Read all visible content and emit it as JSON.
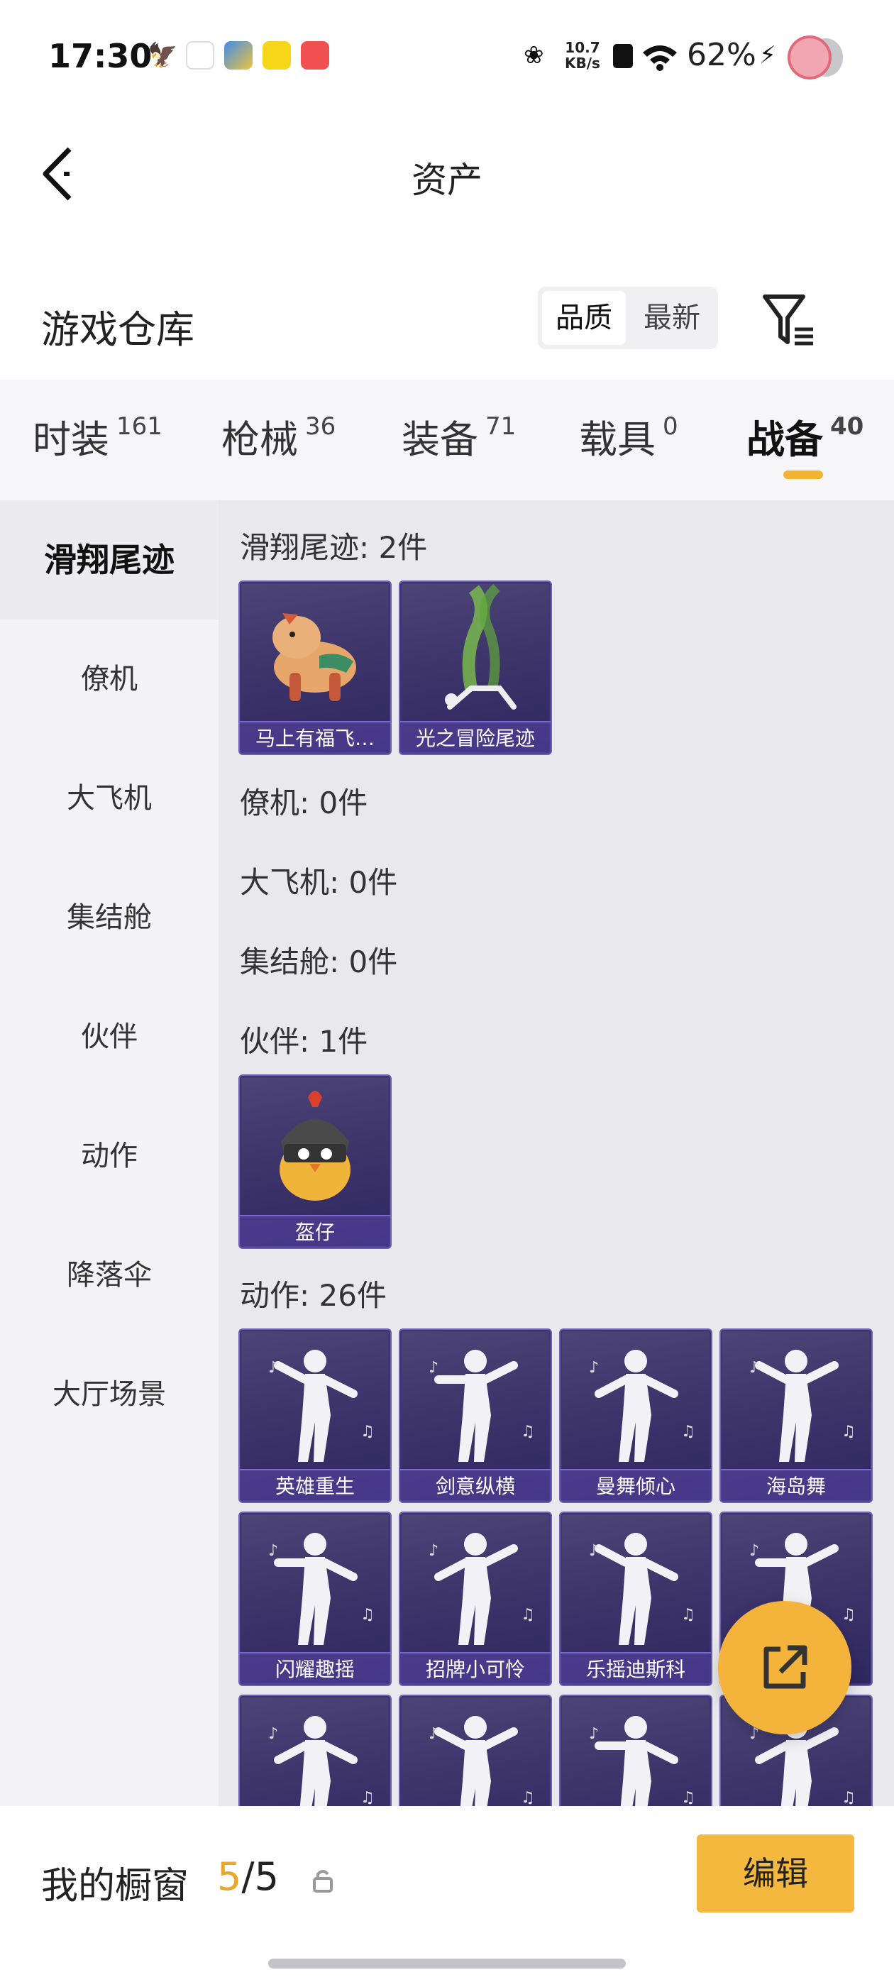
{
  "status_bar": {
    "time": "17:30",
    "net_speed_value": "10.7",
    "net_speed_unit": "KB/s",
    "battery": "62%",
    "icons": [
      "bird-icon",
      "calendar-icon",
      "game-app-icon",
      "yellow-app-icon",
      "red-app-icon",
      "flower-icon",
      "sim-icon",
      "wifi-icon",
      "charging-icon"
    ]
  },
  "header": {
    "title": "资产",
    "back_icon": "chevron-left-icon"
  },
  "section": {
    "title": "游戏仓库",
    "sort_options": [
      "品质",
      "最新"
    ],
    "selected_sort": "品质",
    "filter_icon": "filter-icon"
  },
  "tabs": [
    {
      "label": "时装",
      "count": "161"
    },
    {
      "label": "枪械",
      "count": "36"
    },
    {
      "label": "装备",
      "count": "71"
    },
    {
      "label": "载具",
      "count": "0"
    },
    {
      "label": "战备",
      "count": "40"
    }
  ],
  "active_tab": "战备",
  "sidebar": [
    "滑翔尾迹",
    "僚机",
    "大飞机",
    "集结舱",
    "伙伴",
    "动作",
    "降落伞",
    "大厅场景"
  ],
  "active_sidebar": "滑翔尾迹",
  "groups": [
    {
      "title": "滑翔尾迹: 2件",
      "items": [
        "马上有福飞…",
        "光之冒险尾迹"
      ]
    },
    {
      "title": "僚机: 0件",
      "items": []
    },
    {
      "title": "大飞机: 0件",
      "items": []
    },
    {
      "title": "集结舱: 0件",
      "items": []
    },
    {
      "title": "伙伴: 1件",
      "items": [
        "盔仔"
      ]
    },
    {
      "title": "动作: 26件",
      "items": [
        "英雄重生",
        "剑意纵横",
        "曼舞倾心",
        "海岛舞",
        "闪耀趣摇",
        "招牌小可怜",
        "乐摇迪斯科",
        "",
        "",
        "",
        "",
        ""
      ]
    }
  ],
  "bottom_bar": {
    "label": "我的橱窗",
    "count_current": "5",
    "count_sep": "/",
    "count_total": "5",
    "edit_label": "编辑"
  },
  "colors": {
    "accent": "#F4B83E",
    "card_bg": "#3A3268",
    "card_border": "#6C5FB4"
  }
}
